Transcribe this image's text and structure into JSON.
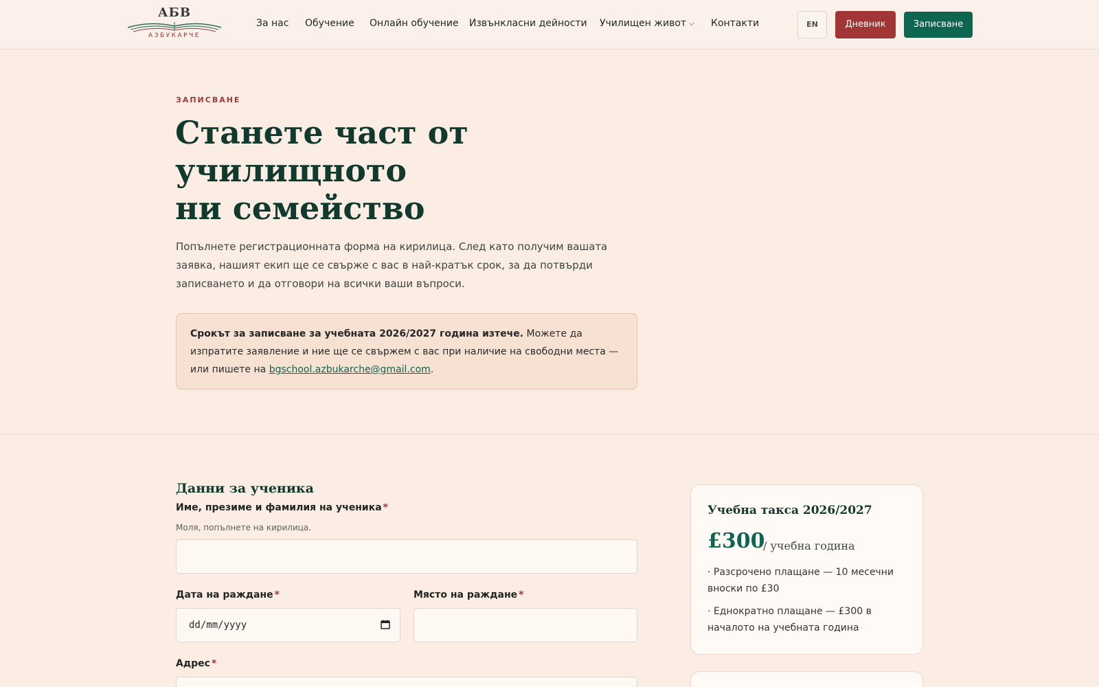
{
  "logo": {
    "mark": "АБВ",
    "name": "АЗБУКАРЧЕ"
  },
  "nav": {
    "items": [
      {
        "label": "За нас"
      },
      {
        "label": "Обучение"
      },
      {
        "label": "Онлайн обучение"
      },
      {
        "label": "Извънкласни дейности"
      },
      {
        "label": "Училищен живот"
      },
      {
        "label": "Контакти"
      }
    ],
    "lang": "EN",
    "diary": "Дневник",
    "enroll": "Записване"
  },
  "hero": {
    "eyebrow": "ЗАПИСВАНЕ",
    "title_1": "Станете част от",
    "title_2": "училищното",
    "title_3": "ни семейство",
    "text": "Попълнете регистрационната форма на кирилица. След като получим вашата заявка, нашият екип ще се свърже с вас в най-кратък срок, за да потвърди записването и да отговори на всички ваши въпроси."
  },
  "notice": {
    "bold": "Срокът за записване за учебната 2026/2027 година изтече.",
    "text": " Можете да изпратите заявление и ние ще се свържем с вас при наличие на свободни места — или пишете на ",
    "email": "bgschool.azbukarche@gmail.com",
    "end": "."
  },
  "form": {
    "section_title": "Данни за ученика",
    "name_label": "Име, презиме и фамилия на ученика",
    "name_hint": "Моля, попълнете на кирилица.",
    "name_value": "",
    "dob_label": "Дата на раждане",
    "dob_placeholder": "dd/mm/yyyy",
    "pob_label": "Място на раждане",
    "pob_value": "",
    "address_label": "Адрес",
    "required_mark": "*"
  },
  "fee": {
    "title": "Учебна такса 2026/2027",
    "price": "£300",
    "unit": "/ учебна година",
    "line1": "· Разсрочено плащане — 10 месечни вноски по £30",
    "line2": "· Еднократно плащане — £300 в началото на учебната година"
  },
  "colors": {
    "background": "#fbede4",
    "brand_green": "#0e6550",
    "brand_red": "#a23536",
    "heading": "#113a2e"
  }
}
